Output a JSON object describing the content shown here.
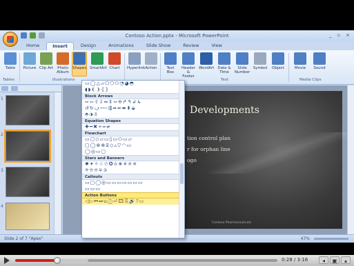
{
  "window": {
    "title": "Contoso Action.pptx - Microsoft PowerPoint",
    "controls": [
      "_",
      "▫",
      "×"
    ]
  },
  "tabs": [
    {
      "label": "Home",
      "active": false
    },
    {
      "label": "Insert",
      "active": true
    },
    {
      "label": "Design",
      "active": false
    },
    {
      "label": "Animations",
      "active": false
    },
    {
      "label": "Slide Show",
      "active": false
    },
    {
      "label": "Review",
      "active": false
    },
    {
      "label": "View",
      "active": false
    }
  ],
  "ribbon": {
    "buttons": [
      {
        "id": "table",
        "label": "Table",
        "color": "#5b8fd6"
      },
      {
        "id": "picture",
        "label": "Picture",
        "color": "#6ea7d8"
      },
      {
        "id": "clipart",
        "label": "Clip Art",
        "color": "#7aa055"
      },
      {
        "id": "photoalbum",
        "label": "Photo Album",
        "color": "#d46b2a"
      },
      {
        "id": "shapes",
        "label": "Shapes",
        "color": "#3b6fb6"
      },
      {
        "id": "smartart",
        "label": "SmartArt",
        "color": "#2f9a55"
      },
      {
        "id": "chart",
        "label": "Chart",
        "color": "#d04a2a"
      },
      {
        "id": "hyperlink",
        "label": "Hyperlink",
        "color": "#8aa0c0"
      },
      {
        "id": "action",
        "label": "Action",
        "color": "#a0b0c8"
      },
      {
        "id": "textbox",
        "label": "Text Box",
        "color": "#4f7fc4"
      },
      {
        "id": "headerfooter",
        "label": "Header & Footer",
        "color": "#4f7fc4"
      },
      {
        "id": "wordart",
        "label": "WordArt",
        "color": "#2c5fa8"
      },
      {
        "id": "datetime",
        "label": "Date & Time",
        "color": "#4f7fc4"
      },
      {
        "id": "slidenumber",
        "label": "Slide Number",
        "color": "#4f7fc4"
      },
      {
        "id": "symbol",
        "label": "Symbol",
        "color": "#9aa8c0"
      },
      {
        "id": "object",
        "label": "Object",
        "color": "#4f7fc4"
      },
      {
        "id": "movie",
        "label": "Movie",
        "color": "#4f7fc4"
      },
      {
        "id": "sound",
        "label": "Sound",
        "color": "#4f7fc4"
      }
    ],
    "groups": [
      "Tables",
      "Illustrations",
      "Text",
      "Media Clips"
    ]
  },
  "shapes_menu": {
    "sections": [
      {
        "name": "",
        "rows": [
          "▭◯△▱⬠⬡⬭◔◕◓",
          "◖◗❨❩⦃⦄"
        ]
      },
      {
        "name": "Block Arrows",
        "rows": [
          "⇨⇦⇧⇩⇔⇕⬄✢↱↰↲↳",
          "↺↻⤻⬳⇶⇏⇍⬌⬍⬙",
          "⬘⬗⇫"
        ]
      },
      {
        "name": "Equation Shapes",
        "rows": [
          "✚━✖÷═≠"
        ]
      },
      {
        "name": "Flowchart",
        "rows": [
          "▭▢◇▱▭▯▭⬭▭▱",
          "▢◯⊗⊕⧖◇▵▽◠▭",
          "◯◎▭▢"
        ]
      },
      {
        "name": "Stars and Banners",
        "rows": [
          "✸✦✧☆✩✪✫✬✭✮✯",
          "⛤⛥⛦⛧✰"
        ]
      },
      {
        "name": "Callouts",
        "rows": [
          "▭▢◯◎▭▭▭▭▭▭▭",
          "▭▭▭"
        ]
      },
      {
        "name": "Action Buttons",
        "rows": [
          "◁▷⏮⏭⌂ⓘ⏎🎞⎘🔊?▭"
        ],
        "highlight": true
      }
    ]
  },
  "slides": {
    "count_label": "Slide 2 of 7",
    "theme_label": "\"Apex\"",
    "numbers": [
      "1",
      "2",
      "3",
      "4"
    ]
  },
  "slide": {
    "title": "Developments",
    "lines": [
      "tion control plan",
      "r for orphan line",
      "ogo"
    ],
    "footer": "Contoso Pharmaceuticals"
  },
  "statusbar": {
    "zoom": "47%"
  },
  "player": {
    "time": "0:28 / 3:16",
    "progress": 0.16,
    "loaded": 0.28
  }
}
